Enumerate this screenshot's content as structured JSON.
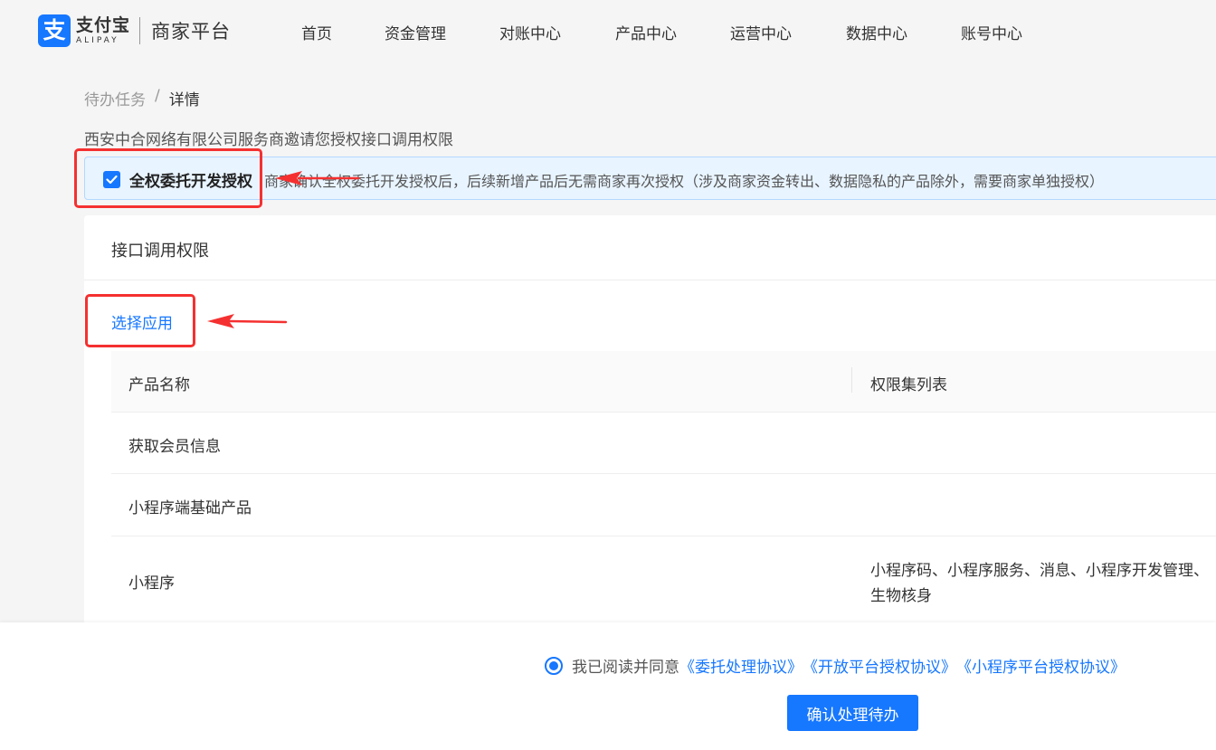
{
  "header": {
    "logo_icon_char": "支",
    "logo_cn": "支付宝",
    "logo_en": "ALIPAY",
    "platform": "商家平台",
    "nav": [
      "首页",
      "资金管理",
      "对账中心",
      "产品中心",
      "运营中心",
      "数据中心",
      "账号中心"
    ]
  },
  "breadcrumb": {
    "parent": "待办任务",
    "separator": "/",
    "current": "详情"
  },
  "invite_text": "西安中合网络有限公司服务商邀请您授权接口调用权限",
  "alert": {
    "checked": true,
    "title": "全权委托开发授权",
    "description": "商家确认全权委托开发授权后，后续新增产品后无需商家再次授权（涉及商家资金转出、数据隐私的产品除外，需要商家单独授权）"
  },
  "card": {
    "title": "接口调用权限",
    "select_app": "选择应用",
    "table": {
      "headers": [
        "产品名称",
        "权限集列表"
      ],
      "rows": [
        {
          "name": "获取会员信息",
          "perms_line1": "",
          "perms_line2": ""
        },
        {
          "name": "小程序端基础产品",
          "perms_line1": "",
          "perms_line2": ""
        },
        {
          "name": "小程序",
          "perms_line1": "小程序码、小程序服务、消息、小程序开发管理、",
          "perms_line2": "生物核身"
        }
      ]
    }
  },
  "footer": {
    "agree_prefix": "我已阅读并同意",
    "links": [
      "《委托处理协议》",
      "《开放平台授权协议》",
      "《小程序平台授权协议》"
    ],
    "confirm_button": "确认处理待办"
  },
  "colors": {
    "primary": "#1677ff",
    "annotation_red": "#f53030",
    "alert_bg": "#e8f4ff"
  }
}
